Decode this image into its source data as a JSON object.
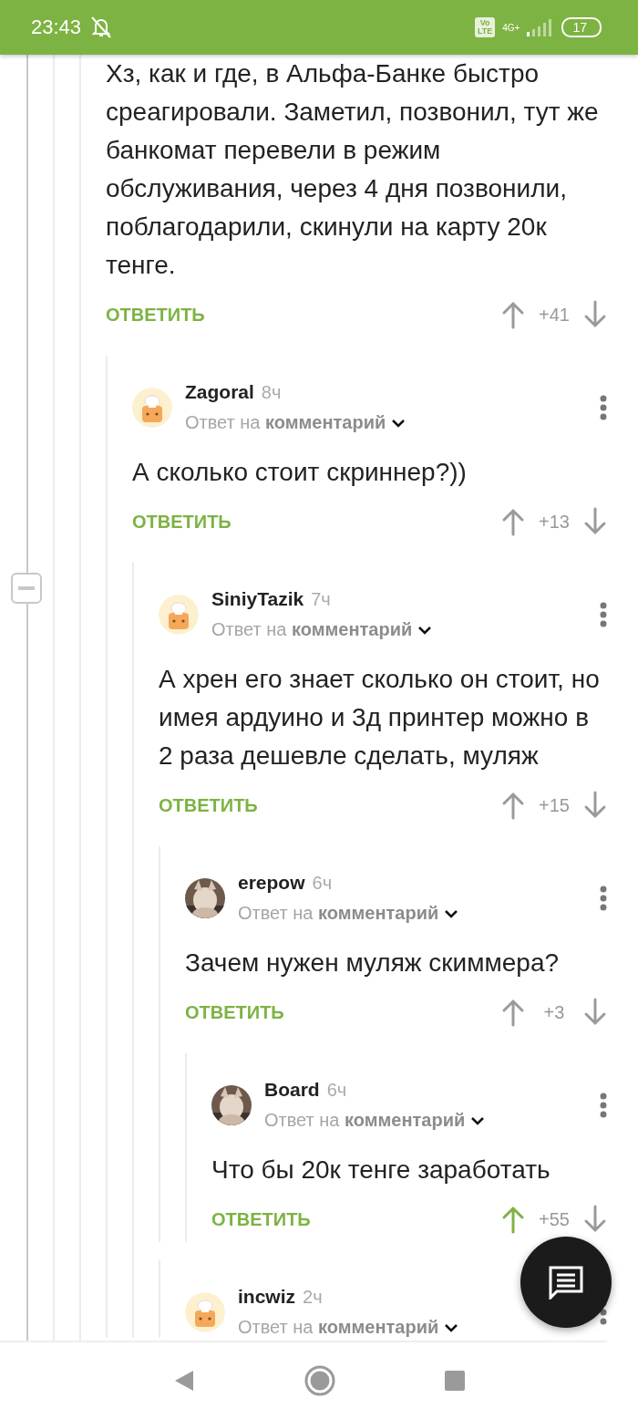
{
  "status_bar": {
    "time": "23:43",
    "volte_top": "Vo",
    "volte_bottom": "LTE",
    "network": "4G+",
    "battery": "17"
  },
  "thread": {
    "body": "Хз, как и где, в Альфа-Банке быстро среагировали. Заметил, позвонил, тут же банкомат перевели в режим обслуживания, через 4 дня позвонили, поблагодарили, скинули на карту 20к тенге.",
    "reply": "ОТВЕТИТЬ",
    "score": "+41",
    "upvoted": false,
    "children": [
      {
        "author": "Zagoral",
        "time": "8ч",
        "kind": "default",
        "reply_to": "Ответ на **комментарий**",
        "body": "А сколько стоит скриннер?))",
        "reply": "ОТВЕТИТЬ",
        "score": "+13",
        "upvoted": false,
        "children": [
          {
            "author": "SiniyTazik",
            "time": "7ч",
            "kind": "default",
            "reply_to": "Ответ на **комментарий**",
            "body": "А хрен его знает сколько он стоит, но имея ардуино и 3д принтер можно в 2 раза дешевле сделать, муляж",
            "reply": "ОТВЕТИТЬ",
            "score": "+15",
            "upvoted": false,
            "children": [
              {
                "author": "erepow",
                "time": "6ч",
                "reply_to": "Ответ на **комментарий**",
                "body": "Зачем нужен муляж скиммера?",
                "reply": "ОТВЕТИТЬ",
                "score": "+3",
                "upvoted": false,
                "children": [
                  {
                    "author": "Board",
                    "time": "6ч",
                    "reply_to": "Ответ на **комментарий**",
                    "body": "Что бы 20к тенге заработать",
                    "reply": "ОТВЕТИТЬ",
                    "score": "+55",
                    "upvoted": true
                  }
                ]
              },
              {
                "author": "incwiz",
                "time": "2ч",
                "kind": "default",
                "reply_to": "Ответ на **комментарий**"
              }
            ]
          }
        ]
      }
    ]
  }
}
